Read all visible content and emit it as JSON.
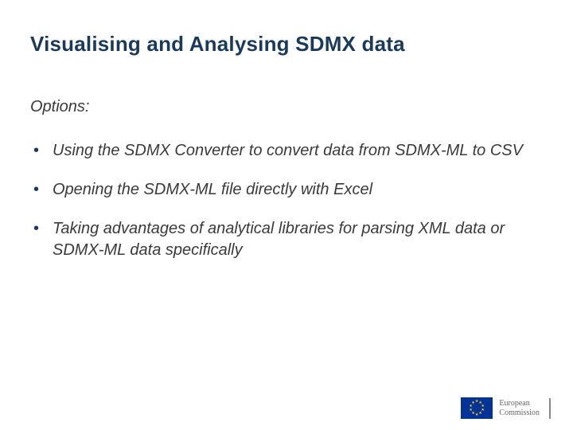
{
  "title": "Visualising and Analysing SDMX data",
  "subtitle": "Options:",
  "bullets": [
    "Using the SDMX Converter to convert data from SDMX-ML to CSV",
    "Opening the SDMX-ML file directly with Excel",
    "Taking advantages of analytical libraries for parsing XML data or SDMX-ML data specifically"
  ],
  "footer": {
    "org_line1": "European",
    "org_line2": "Commission"
  }
}
